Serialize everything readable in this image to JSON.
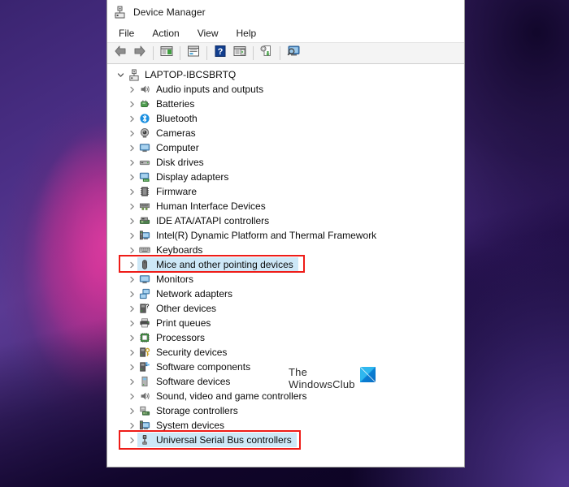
{
  "window": {
    "title": "Device Manager",
    "app_icon": "device-manager-icon"
  },
  "menu": {
    "items": [
      {
        "label": "File"
      },
      {
        "label": "Action"
      },
      {
        "label": "View"
      },
      {
        "label": "Help"
      }
    ]
  },
  "toolbar": {
    "buttons": [
      {
        "name": "back-button",
        "icon": "back-arrow-icon"
      },
      {
        "name": "forward-button",
        "icon": "forward-arrow-icon"
      },
      {
        "name": "separator-1",
        "icon": "separator"
      },
      {
        "name": "show-hide-console-tree-button",
        "icon": "console-tree-icon"
      },
      {
        "name": "separator-2",
        "icon": "separator"
      },
      {
        "name": "properties-button",
        "icon": "properties-window-icon"
      },
      {
        "name": "separator-3",
        "icon": "separator"
      },
      {
        "name": "help-button",
        "icon": "help-question-icon"
      },
      {
        "name": "show-hide-action-pane-button",
        "icon": "action-pane-icon"
      },
      {
        "name": "separator-4",
        "icon": "separator"
      },
      {
        "name": "update-driver-button",
        "icon": "update-driver-icon"
      },
      {
        "name": "separator-5",
        "icon": "separator"
      },
      {
        "name": "scan-for-hardware-changes-button",
        "icon": "scan-hardware-icon"
      }
    ]
  },
  "tree": {
    "root": {
      "label": "LAPTOP-IBCSBRTQ",
      "icon": "computer-root-icon",
      "expanded": true,
      "chevron": "chevron-down-icon"
    },
    "nodes": [
      {
        "label": "Audio inputs and outputs",
        "icon": "speaker-icon",
        "selected": false
      },
      {
        "label": "Batteries",
        "icon": "battery-icon",
        "selected": false
      },
      {
        "label": "Bluetooth",
        "icon": "bluetooth-icon",
        "selected": false
      },
      {
        "label": "Cameras",
        "icon": "camera-icon",
        "selected": false
      },
      {
        "label": "Computer",
        "icon": "monitor-icon",
        "selected": false
      },
      {
        "label": "Disk drives",
        "icon": "disk-drive-icon",
        "selected": false
      },
      {
        "label": "Display adapters",
        "icon": "display-adapter-icon",
        "selected": false
      },
      {
        "label": "Firmware",
        "icon": "firmware-chip-icon",
        "selected": false
      },
      {
        "label": "Human Interface Devices",
        "icon": "hid-icon",
        "selected": false
      },
      {
        "label": "IDE ATA/ATAPI controllers",
        "icon": "ide-controller-icon",
        "selected": false
      },
      {
        "label": "Intel(R) Dynamic Platform and Thermal Framework",
        "icon": "thermal-framework-icon",
        "selected": false
      },
      {
        "label": "Keyboards",
        "icon": "keyboard-icon",
        "selected": false
      },
      {
        "label": "Mice and other pointing devices",
        "icon": "mouse-icon",
        "selected": true,
        "highlighted": true
      },
      {
        "label": "Monitors",
        "icon": "monitor-icon",
        "selected": false
      },
      {
        "label": "Network adapters",
        "icon": "network-adapter-icon",
        "selected": false
      },
      {
        "label": "Other devices",
        "icon": "other-device-icon",
        "selected": false
      },
      {
        "label": "Print queues",
        "icon": "printer-icon",
        "selected": false
      },
      {
        "label": "Processors",
        "icon": "processor-icon",
        "selected": false
      },
      {
        "label": "Security devices",
        "icon": "security-device-icon",
        "selected": false
      },
      {
        "label": "Software components",
        "icon": "software-component-icon",
        "selected": false
      },
      {
        "label": "Software devices",
        "icon": "software-device-icon",
        "selected": false
      },
      {
        "label": "Sound, video and game controllers",
        "icon": "speaker-icon",
        "selected": false
      },
      {
        "label": "Storage controllers",
        "icon": "storage-controller-icon",
        "selected": false
      },
      {
        "label": "System devices",
        "icon": "system-device-icon",
        "selected": false
      },
      {
        "label": "Universal Serial Bus controllers",
        "icon": "usb-icon",
        "selected": true,
        "highlighted": true
      }
    ],
    "child_chevron": "chevron-right-icon"
  },
  "annotations": {
    "highlight_color": "#ee1c18",
    "selection_color": "#cde8f7",
    "boxes": [
      {
        "name": "mice-and-other-pointing-devices-highlight",
        "target": "Mice and other pointing devices"
      },
      {
        "name": "universal-serial-bus-controllers-highlight",
        "target": "Universal Serial Bus controllers"
      }
    ]
  },
  "watermark": {
    "line1": "The",
    "line2": "WindowsClub",
    "logo": "windowsclub-logo"
  }
}
